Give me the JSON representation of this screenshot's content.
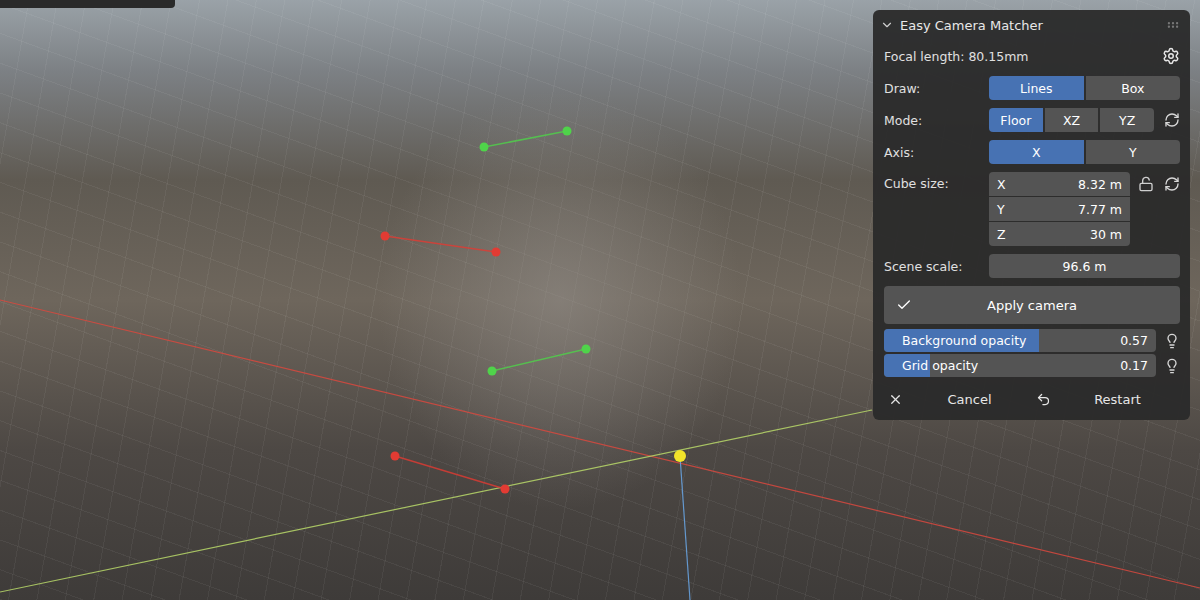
{
  "panel": {
    "title": "Easy Camera Matcher",
    "focal_length": "Focal length: 80.15mm",
    "rows": [
      {
        "label": "Draw:",
        "has_reset": false,
        "options": [
          {
            "label": "Lines",
            "selected": true
          },
          {
            "label": "Box",
            "selected": false
          }
        ]
      },
      {
        "label": "Mode:",
        "has_reset": true,
        "options": [
          {
            "label": "Floor",
            "selected": true
          },
          {
            "label": "XZ",
            "selected": false
          },
          {
            "label": "YZ",
            "selected": false
          }
        ]
      },
      {
        "label": "Axis:",
        "has_reset": false,
        "options": [
          {
            "label": "X",
            "selected": true
          },
          {
            "label": "Y",
            "selected": false
          }
        ]
      }
    ],
    "cube_size": {
      "label": "Cube size:",
      "locked": false,
      "fields": [
        {
          "axis": "X",
          "value": "8.32 m"
        },
        {
          "axis": "Y",
          "value": "7.77 m"
        },
        {
          "axis": "Z",
          "value": "30 m"
        }
      ]
    },
    "scene_scale": {
      "label": "Scene scale:",
      "value": "96.6 m"
    },
    "apply": {
      "label": "Apply camera",
      "checked": true
    },
    "sliders": [
      {
        "label": "Background opacity",
        "value": "0.57",
        "level": 0.57
      },
      {
        "label": "Grid opacity",
        "value": "0.17",
        "level": 0.17
      }
    ],
    "footer": [
      {
        "label": "Cancel",
        "kind": "cancel"
      },
      {
        "label": "Restart",
        "kind": "restart"
      }
    ]
  },
  "viewport": {
    "guides": [
      {
        "kind": "axis-line",
        "color": "#d9493f"
      },
      {
        "kind": "axis-line",
        "color": "#b9d96a"
      },
      {
        "kind": "axis-line",
        "color": "#6aa8e8"
      },
      {
        "kind": "segment",
        "color": "#e23b33"
      },
      {
        "kind": "segment",
        "color": "#e23b33"
      },
      {
        "kind": "segment",
        "color": "#4fd34a"
      },
      {
        "kind": "segment",
        "color": "#4fd34a"
      },
      {
        "kind": "origin",
        "color": "#f2e42a"
      }
    ]
  }
}
